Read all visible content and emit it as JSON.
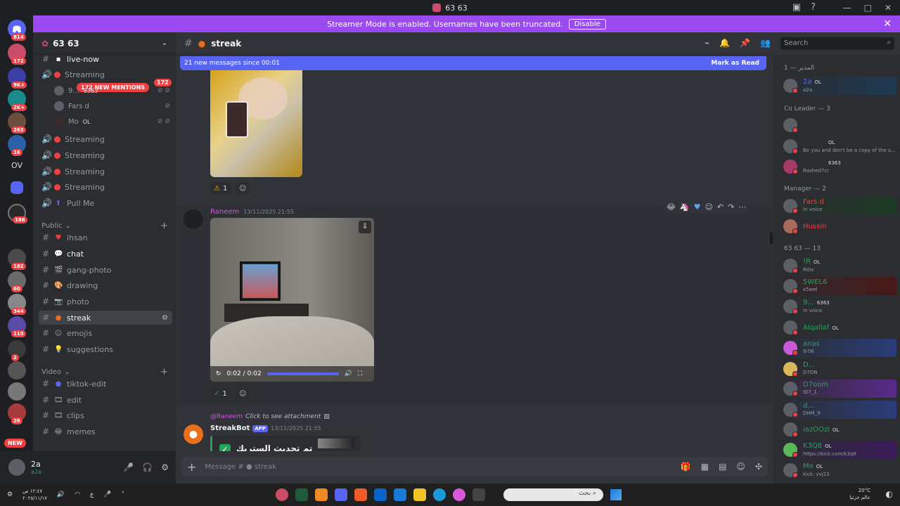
{
  "window": {
    "title": "63 63"
  },
  "banner": {
    "text": "Streamer Mode is enabled. Usernames have been truncated.",
    "button": "Disable"
  },
  "servers": [
    {
      "label": "",
      "badge": "814"
    },
    {
      "label": "",
      "badge": "172"
    },
    {
      "label": "",
      "badge": "9K+"
    },
    {
      "label": "",
      "badge": "2K+"
    },
    {
      "label": "",
      "badge": "263"
    },
    {
      "label": "",
      "badge": "16"
    },
    {
      "label": "OV",
      "badge": ""
    },
    {
      "label": "",
      "badge": "186"
    },
    {
      "label": "",
      "badge": "182"
    },
    {
      "label": "",
      "badge": "60"
    },
    {
      "label": "",
      "badge": "344"
    },
    {
      "label": "",
      "badge": "115"
    },
    {
      "label": "",
      "badge": "2"
    },
    {
      "label": "",
      "badge": "26"
    }
  ],
  "new_pill": "NEW",
  "guild": {
    "name": "63 63"
  },
  "channels": {
    "mentions": "172 NEW MENTIONS",
    "top_count": "172",
    "top_partial": "live-now",
    "streaming_label": "Streaming",
    "voice_users": [
      {
        "name": "9...",
        "tag": "6363"
      },
      {
        "name": "Fars d",
        "tag": ""
      },
      {
        "name": "Mo",
        "tag": "OL"
      }
    ],
    "pull_me": "Pull Me",
    "categories": {
      "public": "Public",
      "video": "Video"
    },
    "public_list": [
      "ihsan",
      "chat",
      "gang-photo",
      "drawing",
      "photo",
      "streak",
      "emojis",
      "suggestions"
    ],
    "video_list": [
      "tiktok-edit",
      "edit",
      "clips",
      "memes"
    ]
  },
  "user_panel": {
    "name": "2a",
    "status": "a2a"
  },
  "channel_header": {
    "name": "streak",
    "search_placeholder": "Search"
  },
  "new_messages": {
    "text": "21 new messages since 00:01",
    "action": "Mark as Read"
  },
  "messages": {
    "first_reactions": [
      {
        "emoji": "⚠",
        "count": "1"
      }
    ],
    "raneem": {
      "author": "Raneem",
      "timestamp": "13/11/2025 21:55"
    },
    "video": {
      "time": "0:02 / 0:02",
      "progress": 1.0
    },
    "second_reactions": [
      {
        "emoji": "✓",
        "count": "1"
      }
    ],
    "bot_reply": {
      "user": "@Raneem",
      "click": "Click to see attachment"
    },
    "bot": {
      "author": "StreakBot",
      "badge": "APP",
      "timestamp": "13/11/2025 21:55",
      "embed_text": "تم تحديث الستريك"
    }
  },
  "composer": {
    "placeholder": "Message #",
    "channel": "streak"
  },
  "members": {
    "groups": [
      {
        "label": "المدير — 1"
      },
      {
        "label": "Co Leader — 3"
      },
      {
        "label": "Manager — 2"
      },
      {
        "label": "63 63 — 13"
      }
    ],
    "list": [
      {
        "name": "2a",
        "tag": "OL",
        "sub": "a2a",
        "color": "#5865f2"
      },
      {
        "name": "",
        "tag": "",
        "sub": "",
        "color": "#dbdee1"
      },
      {
        "name": "",
        "tag": "OL",
        "sub": "Be you and don't be a copy of the o...",
        "color": "#dbdee1"
      },
      {
        "name": "",
        "tag": "6363",
        "sub": "Rashed7cr",
        "color": "#dbdee1"
      },
      {
        "name": "Fars d",
        "tag": "",
        "sub": "In voice",
        "color": "#f23f43"
      },
      {
        "name": "Hussin",
        "tag": "",
        "sub": "",
        "color": "#f23f43"
      },
      {
        "name": "!R",
        "tag": "OL",
        "sub": "RI0x",
        "color": "#23a559"
      },
      {
        "name": "5WEL6",
        "tag": "",
        "sub": "x5wel",
        "color": "#23a559"
      },
      {
        "name": "9...",
        "tag": "6363",
        "sub": "In voice",
        "color": "#23a559"
      },
      {
        "name": "Alqallaf",
        "tag": "OL",
        "sub": "",
        "color": "#23a559"
      },
      {
        "name": "anas",
        "tag": "",
        "sub": "9:06",
        "color": "#23a559"
      },
      {
        "name": "D...",
        "tag": "",
        "sub": "D7DN",
        "color": "#23a559"
      },
      {
        "name": "D7oom",
        "tag": "",
        "sub": "ID7_1",
        "color": "#23a559"
      },
      {
        "name": "d...",
        "tag": "",
        "sub": "DHM_9",
        "color": "#23a559"
      },
      {
        "name": "iazOOzi",
        "tag": "OL",
        "sub": "",
        "color": "#23a559"
      },
      {
        "name": "K3Q8",
        "tag": "OL",
        "sub": "https://kick.com/k3q8",
        "color": "#23a559"
      },
      {
        "name": "Mo",
        "tag": "OL",
        "sub": "kick: vvj23",
        "color": "#23a559"
      }
    ]
  },
  "taskbar": {
    "time": "١٢:٤٧ ص",
    "date": "٢٠٢٥/١١/١٧",
    "weather": "20°C",
    "weather_sub": "عالم جزئيا",
    "search": "بحث"
  }
}
